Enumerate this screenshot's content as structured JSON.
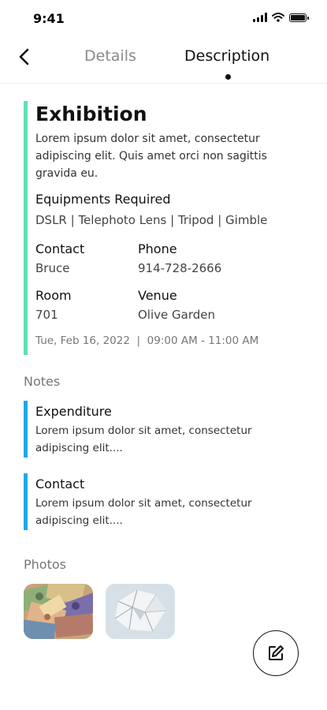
{
  "status_bar": {
    "time": "9:41"
  },
  "nav": {
    "tabs": [
      {
        "label": "Details"
      },
      {
        "label": "Description"
      }
    ]
  },
  "event": {
    "title": "Exhibition",
    "description": "Lorem ipsum dolor sit amet, consectetur adipiscing elit. Quis amet orci non sagittis gravida eu.",
    "equipments_label": "Equipments Required",
    "equipments": "DSLR | Telephoto Lens | Tripod | Gimble",
    "contact_label": "Contact",
    "contact_value": "Bruce",
    "phone_label": "Phone",
    "phone_value": "914-728-2666",
    "room_label": "Room",
    "room_value": "701",
    "venue_label": "Venue",
    "venue_value": "Olive Garden",
    "datetime": "Tue, Feb 16, 2022  |  09:00 AM - 11:00 AM"
  },
  "notes": {
    "heading": "Notes",
    "items": [
      {
        "title": "Expenditure",
        "body": "Lorem ipsum dolor sit amet, consectetur adipiscing elit...."
      },
      {
        "title": "Contact",
        "body": "Lorem ipsum dolor sit amet, consectetur adipiscing elit...."
      }
    ]
  },
  "photos": {
    "heading": "Photos",
    "items": [
      {
        "icon": "banknotes-photo"
      },
      {
        "icon": "crumpled-paper-photo"
      }
    ]
  },
  "colors": {
    "event_accent": "#5fe0b5",
    "note_accent": "#1fa8e8"
  },
  "icons": {
    "back": "chevron-left-icon",
    "edit": "edit-icon"
  }
}
